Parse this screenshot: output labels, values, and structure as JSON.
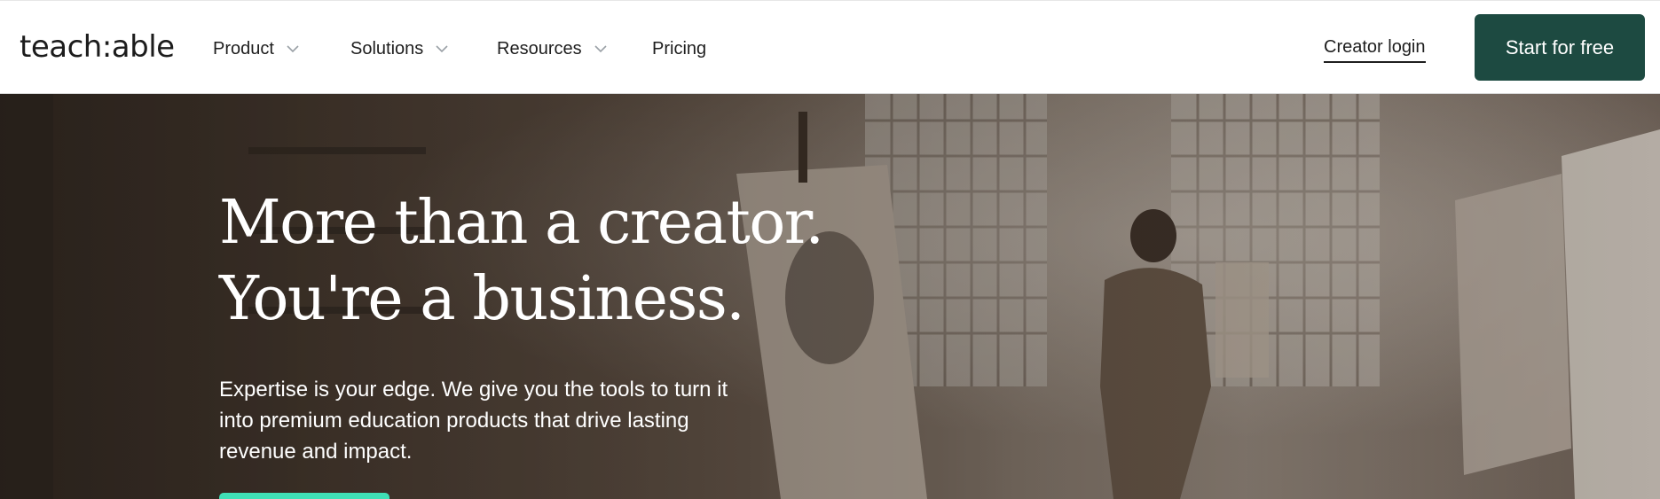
{
  "brand": {
    "logo_text": "teach:able"
  },
  "nav": {
    "items": [
      {
        "label": "Product",
        "has_dropdown": true
      },
      {
        "label": "Solutions",
        "has_dropdown": true
      },
      {
        "label": "Resources",
        "has_dropdown": true
      },
      {
        "label": "Pricing",
        "has_dropdown": false
      }
    ],
    "login_label": "Creator login",
    "cta_label": "Start for free"
  },
  "hero": {
    "headline_line1": "More than a creator.",
    "headline_line2": "You're a business.",
    "subtext_line1": "Expertise is your edge. We give you the tools to turn it",
    "subtext_line2": "into premium education products that drive lasting",
    "subtext_line3": "revenue and impact."
  },
  "colors": {
    "cta_background": "#1d4a41",
    "hero_cta_accent": "#3fe0b6",
    "text_dark": "#1e1e1e"
  }
}
